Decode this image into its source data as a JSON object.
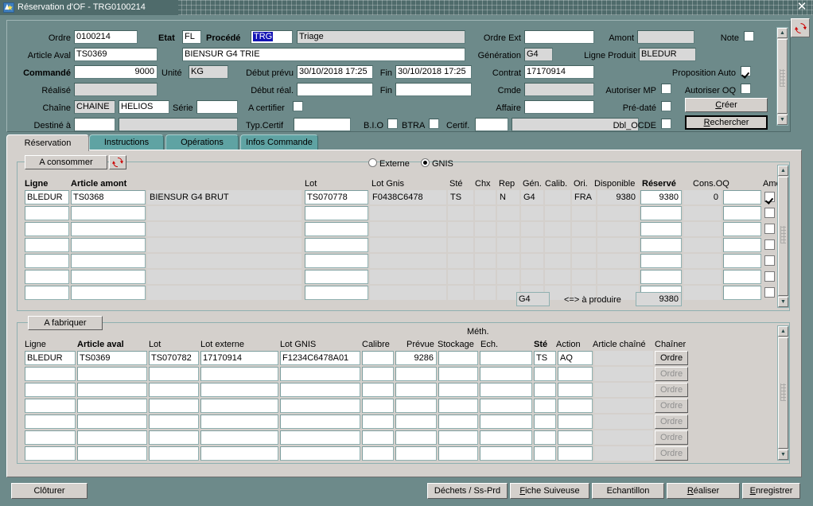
{
  "window": {
    "title": "Réservation d'OF - TRG0100214",
    "icon": "app-icon",
    "close_label": "✕",
    "refresh_icon": "refresh-icon"
  },
  "header": {
    "labels": {
      "ordre": "Ordre",
      "etat": "Etat",
      "procede": "Procédé",
      "article_aval": "Article Aval",
      "commande": "Commandé",
      "unite": "Unité",
      "debut_prevu": "Début prévu",
      "fin1": "Fin",
      "realise": "Réalisé",
      "debut_reel": "Début réal.",
      "fin2": "Fin",
      "chaine": "Chaîne",
      "serie": "Série",
      "a_certifier": "A certifier",
      "destine_a": "Destiné à",
      "typ_certif": "Typ.Certif",
      "bio": "B.I.O",
      "btra": "BTRA",
      "certif": "Certif.",
      "ordre_ext": "Ordre Ext",
      "amont": "Amont",
      "note": "Note",
      "generation": "Génération",
      "ligne_produit": "Ligne Produit",
      "contrat": "Contrat",
      "proposition_auto": "Proposition Auto",
      "cmde": "Cmde",
      "autoriser_mp": "Autoriser MP",
      "autoriser_oq": "Autoriser OQ",
      "affaire": "Affaire",
      "pre_date": "Pré-daté",
      "dbl_ocde": "Dbl_OCDE"
    },
    "values": {
      "ordre": "0100214",
      "etat": "FL",
      "procede_code_selected": "TRG",
      "procede_label": "Triage",
      "article_aval": "TS0369",
      "article_aval_desc": "BIENSUR G4 TRIE",
      "commande": "9000",
      "unite": "KG",
      "debut_prevu": "30/10/2018 17:25",
      "fin1": "30/10/2018 17:25",
      "realise": "",
      "debut_reel": "",
      "fin2": "",
      "chaine1": "CHAINE",
      "chaine2": "HELIOS",
      "serie": "",
      "destine_a": "",
      "destine_a_desc": "",
      "typ_certif": "",
      "certif": "",
      "certif_desc": "",
      "ordre_ext": "",
      "amont": "",
      "generation": "G4",
      "ligne_produit": "BLEDUR",
      "contrat": "17170914",
      "cmde": "",
      "affaire": ""
    },
    "checkboxes": {
      "a_certifier": false,
      "bio": false,
      "btra": false,
      "note": false,
      "proposition_auto": true,
      "autoriser_mp": false,
      "autoriser_oq": false,
      "pre_date": false,
      "dbl_ocde": false
    },
    "buttons": {
      "creer": "Créer",
      "creer_accel": "C",
      "rechercher": "Rechercher",
      "rechercher_accel": "R"
    }
  },
  "tabs": [
    {
      "label": "Réservation",
      "active": true
    },
    {
      "label": "Instructions",
      "active": false
    },
    {
      "label": "Opérations",
      "active": false
    },
    {
      "label": "Infos Commande",
      "active": false
    }
  ],
  "consume_panel": {
    "button_label": "A consommer",
    "refresh_icon": "refresh-icon",
    "radios": [
      {
        "label": "Externe",
        "selected": false
      },
      {
        "label": "GNIS",
        "selected": true
      }
    ],
    "columns": [
      {
        "label": "Ligne",
        "bold": true
      },
      {
        "label": "Article amont",
        "bold": true
      },
      {
        "label": "",
        "bold": false
      },
      {
        "label": "Lot",
        "bold": false
      },
      {
        "label": "Lot Gnis",
        "bold": false
      },
      {
        "label": "Sté",
        "bold": false
      },
      {
        "label": "Chx",
        "bold": false
      },
      {
        "label": "Rep",
        "bold": false
      },
      {
        "label": "Gén.",
        "bold": false
      },
      {
        "label": "Calib.",
        "bold": false
      },
      {
        "label": "Ori.",
        "bold": false
      },
      {
        "label": "Disponible",
        "bold": false
      },
      {
        "label": "Réservé",
        "bold": true
      },
      {
        "label": "Cons.OQ",
        "bold": false
      },
      {
        "label": "",
        "bold": false
      },
      {
        "label": "Amont",
        "bold": false
      }
    ],
    "rows": [
      {
        "ligne": "BLEDUR",
        "article_amont": "TS0368",
        "designation": "BIENSUR G4 BRUT",
        "lot": "TS070778",
        "lot_gnis": "F0438C6478",
        "ste": "TS",
        "chx": "",
        "rep": "N",
        "gen": "G4",
        "calib": "",
        "ori": "FRA",
        "disponible": "9380",
        "reserve": "9380",
        "cons_oq": "0",
        "extra": "",
        "amont_checked": true
      },
      {
        "ligne": "",
        "article_amont": "",
        "designation": "",
        "lot": "",
        "lot_gnis": "",
        "ste": "",
        "chx": "",
        "rep": "",
        "gen": "",
        "calib": "",
        "ori": "",
        "disponible": "",
        "reserve": "",
        "cons_oq": "",
        "extra": "",
        "amont_checked": false
      },
      {
        "ligne": "",
        "article_amont": "",
        "designation": "",
        "lot": "",
        "lot_gnis": "",
        "ste": "",
        "chx": "",
        "rep": "",
        "gen": "",
        "calib": "",
        "ori": "",
        "disponible": "",
        "reserve": "",
        "cons_oq": "",
        "extra": "",
        "amont_checked": false
      },
      {
        "ligne": "",
        "article_amont": "",
        "designation": "",
        "lot": "",
        "lot_gnis": "",
        "ste": "",
        "chx": "",
        "rep": "",
        "gen": "",
        "calib": "",
        "ori": "",
        "disponible": "",
        "reserve": "",
        "cons_oq": "",
        "extra": "",
        "amont_checked": false
      },
      {
        "ligne": "",
        "article_amont": "",
        "designation": "",
        "lot": "",
        "lot_gnis": "",
        "ste": "",
        "chx": "",
        "rep": "",
        "gen": "",
        "calib": "",
        "ori": "",
        "disponible": "",
        "reserve": "",
        "cons_oq": "",
        "extra": "",
        "amont_checked": false
      },
      {
        "ligne": "",
        "article_amont": "",
        "designation": "",
        "lot": "",
        "lot_gnis": "",
        "ste": "",
        "chx": "",
        "rep": "",
        "gen": "",
        "calib": "",
        "ori": "",
        "disponible": "",
        "reserve": "",
        "cons_oq": "",
        "extra": "",
        "amont_checked": false
      },
      {
        "ligne": "",
        "article_amont": "",
        "designation": "",
        "lot": "",
        "lot_gnis": "",
        "ste": "",
        "chx": "",
        "rep": "",
        "gen": "",
        "calib": "",
        "ori": "",
        "disponible": "",
        "reserve": "",
        "cons_oq": "",
        "extra": "",
        "amont_checked": false
      }
    ],
    "summary": {
      "generation": "G4",
      "arrow_label": "<=> à produire",
      "quantity": "9380"
    }
  },
  "fabricate_panel": {
    "button_label": "A fabriquer",
    "column_group_label": "Méth.",
    "columns": [
      {
        "label": "Ligne",
        "bold": false
      },
      {
        "label": "Article aval",
        "bold": true
      },
      {
        "label": "Lot",
        "bold": false
      },
      {
        "label": "Lot externe",
        "bold": false
      },
      {
        "label": "Lot GNIS",
        "bold": false
      },
      {
        "label": "Calibre",
        "bold": false
      },
      {
        "label": "Prévue",
        "bold": false
      },
      {
        "label": "Stockage",
        "bold": false
      },
      {
        "label": "Ech.",
        "bold": false
      },
      {
        "label": "Sté",
        "bold": true
      },
      {
        "label": "Action",
        "bold": false
      },
      {
        "label": "Article chaîné",
        "bold": false
      },
      {
        "label": "Chaîner",
        "bold": false
      }
    ],
    "rows": [
      {
        "ligne": "BLEDUR",
        "article_aval": "TS0369",
        "lot": "TS070782",
        "lot_externe": "17170914",
        "lot_gnis": "F1234C6478A01",
        "calibre": "",
        "prevue": "9286",
        "stockage": "",
        "ech": "",
        "ste": "TS",
        "action": "AQ",
        "article_chaine": "",
        "chainer_label": "Ordre",
        "chainer_enabled": true
      },
      {
        "ligne": "",
        "article_aval": "",
        "lot": "",
        "lot_externe": "",
        "lot_gnis": "",
        "calibre": "",
        "prevue": "",
        "stockage": "",
        "ech": "",
        "ste": "",
        "action": "",
        "article_chaine": "",
        "chainer_label": "Ordre",
        "chainer_enabled": false
      },
      {
        "ligne": "",
        "article_aval": "",
        "lot": "",
        "lot_externe": "",
        "lot_gnis": "",
        "calibre": "",
        "prevue": "",
        "stockage": "",
        "ech": "",
        "ste": "",
        "action": "",
        "article_chaine": "",
        "chainer_label": "Ordre",
        "chainer_enabled": false
      },
      {
        "ligne": "",
        "article_aval": "",
        "lot": "",
        "lot_externe": "",
        "lot_gnis": "",
        "calibre": "",
        "prevue": "",
        "stockage": "",
        "ech": "",
        "ste": "",
        "action": "",
        "article_chaine": "",
        "chainer_label": "Ordre",
        "chainer_enabled": false
      },
      {
        "ligne": "",
        "article_aval": "",
        "lot": "",
        "lot_externe": "",
        "lot_gnis": "",
        "calibre": "",
        "prevue": "",
        "stockage": "",
        "ech": "",
        "ste": "",
        "action": "",
        "article_chaine": "",
        "chainer_label": "Ordre",
        "chainer_enabled": false
      },
      {
        "ligne": "",
        "article_aval": "",
        "lot": "",
        "lot_externe": "",
        "lot_gnis": "",
        "calibre": "",
        "prevue": "",
        "stockage": "",
        "ech": "",
        "ste": "",
        "action": "",
        "article_chaine": "",
        "chainer_label": "Ordre",
        "chainer_enabled": false
      },
      {
        "ligne": "",
        "article_aval": "",
        "lot": "",
        "lot_externe": "",
        "lot_gnis": "",
        "calibre": "",
        "prevue": "",
        "stockage": "",
        "ech": "",
        "ste": "",
        "action": "",
        "article_chaine": "",
        "chainer_label": "Ordre",
        "chainer_enabled": false
      }
    ]
  },
  "footer": {
    "cloturer": "Clôturer",
    "dechets": "Déchets / Ss-Prd",
    "fiche_suiveuse": "Fiche Suiveuse",
    "fiche_suiveuse_accel": "F",
    "echantillon": "Echantillon",
    "realiser": "Réaliser",
    "realiser_accel": "R",
    "enregistrer": "Enregistrer",
    "enregistrer_accel": "E"
  },
  "colors": {
    "teal_panel": "#6d8a8a",
    "titlebar": "#4f6b6b",
    "dialog_face": "#d4d0cc",
    "tab_inactive": "#5fa3a3",
    "selection_blue": "#1414b4",
    "field_border": "#5f7d7d"
  }
}
